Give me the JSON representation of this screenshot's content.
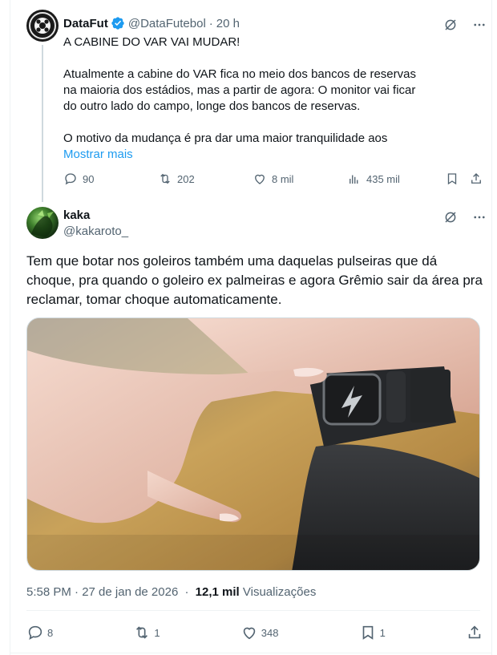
{
  "parent_tweet": {
    "author_name": "DataFut",
    "handle": "@DataFutebol",
    "time": "20 h",
    "paragraphs": [
      "A CABINE DO VAR VAI MUDAR!",
      "Atualmente a cabine do VAR fica no meio dos bancos de reservas na maioria dos estádios, mas a partir de agora: O monitor vai ficar do outro lado do campo, longe dos bancos de reservas.",
      "O motivo da mudança é pra dar uma maior tranquilidade aos"
    ],
    "show_more": "Mostrar mais",
    "stats": {
      "replies": "90",
      "reposts": "202",
      "likes": "8 mil",
      "views": "435 mil"
    }
  },
  "main_tweet": {
    "author_name": "kaka",
    "handle": "@kakaroto_",
    "text": "Tem que botar nos goleiros também uma daquelas pulseiras que dá choque, pra quando o goleiro ex palmeiras e agora Grêmio sair da área pra reclamar, tomar choque automaticamente.",
    "timestamp": "5:58 PM · 27 de jan de 2026",
    "views_count": "12,1 mil",
    "views_label": "Visualizações",
    "stats": {
      "replies": "8",
      "reposts": "1",
      "likes": "348",
      "bookmarks": "1"
    }
  },
  "colors": {
    "accent": "#1d9bf0",
    "text": "#0f1419",
    "muted": "#536471",
    "border": "#eff3f4"
  },
  "icons": [
    "grok-icon",
    "more-icon",
    "reply-icon",
    "repost-icon",
    "like-icon",
    "views-icon",
    "bookmark-icon",
    "share-icon",
    "verified-badge-icon"
  ]
}
